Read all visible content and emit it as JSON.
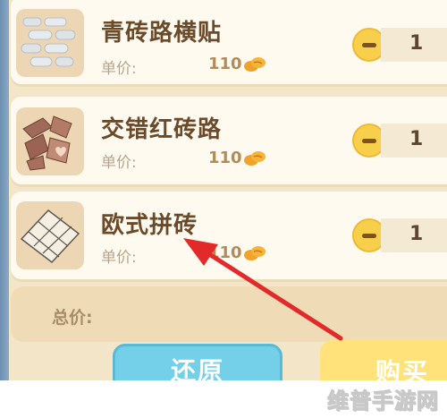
{
  "items": [
    {
      "name": "青砖路横贴",
      "price_label": "单价:",
      "price": "110",
      "quantity": "1",
      "icon": "grey-brick-path-icon"
    },
    {
      "name": "交错红砖路",
      "price_label": "单价:",
      "price": "110",
      "quantity": "1",
      "icon": "red-brick-path-icon"
    },
    {
      "name": "欧式拼砖",
      "price_label": "单价:",
      "price": "110",
      "quantity": "1",
      "icon": "european-tile-icon"
    }
  ],
  "currency_icon": "bean-coin-icon",
  "total_label": "总价:",
  "buttons": {
    "reset": "还原",
    "buy": "购买"
  },
  "watermark": "维普手游网",
  "colors": {
    "accent_yellow": "#f7cf4a",
    "reset_blue": "#74cfe8",
    "arrow_red": "#e32a2a",
    "title_brown": "#6b4a2a"
  }
}
